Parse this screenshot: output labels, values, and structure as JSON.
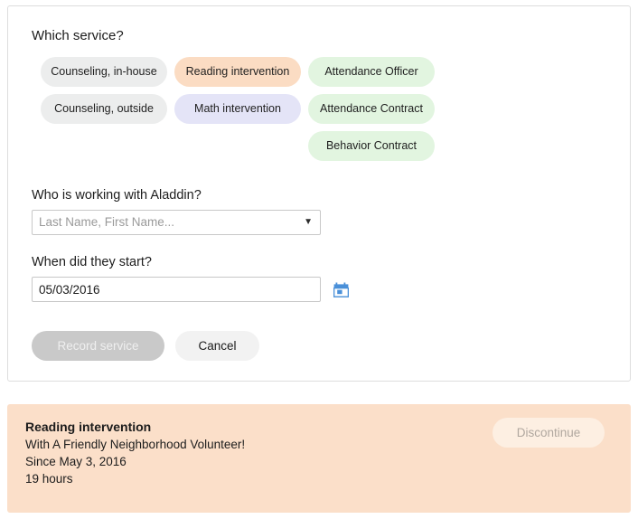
{
  "form": {
    "service_question": "Which service?",
    "service_options": [
      {
        "label": "Counseling, in-house",
        "color_name": "gray",
        "color": "#eceded",
        "col": 1,
        "row": 1,
        "selected": false
      },
      {
        "label": "Counseling, outside",
        "color_name": "gray",
        "color": "#eceded",
        "col": 1,
        "row": 2,
        "selected": false
      },
      {
        "label": "Reading intervention",
        "color_name": "peach",
        "color": "#fbdcc3",
        "col": 2,
        "row": 1,
        "selected": true
      },
      {
        "label": "Math intervention",
        "color_name": "purple",
        "color": "#e4e4f7",
        "col": 2,
        "row": 2,
        "selected": false
      },
      {
        "label": "Attendance Officer",
        "color_name": "green",
        "color": "#e2f5e0",
        "col": 3,
        "row": 1,
        "selected": false
      },
      {
        "label": "Attendance Contract",
        "color_name": "green",
        "color": "#e2f5e0",
        "col": 3,
        "row": 2,
        "selected": false
      },
      {
        "label": "Behavior Contract",
        "color_name": "green",
        "color": "#e2f5e0",
        "col": 3,
        "row": 3,
        "selected": false
      }
    ],
    "staff": {
      "label": "Who is working with Aladdin?",
      "value": "",
      "placeholder": "Last Name, First Name...",
      "caret_icon": "▼"
    },
    "start_date": {
      "label": "When did they start?",
      "value": "05/03/2016",
      "calendar_icon": "calendar-icon",
      "calendar_icon_color": "#4a90d9"
    },
    "buttons": {
      "record": "Record service",
      "record_disabled": true,
      "cancel": "Cancel"
    }
  },
  "active_service": {
    "title": "Reading intervention",
    "provider": "With A Friendly Neighborhood Volunteer!",
    "since": "Since May 3, 2016",
    "duration": "19 hours",
    "discontinue_label": "Discontinue",
    "background": "#fbdfc9"
  }
}
